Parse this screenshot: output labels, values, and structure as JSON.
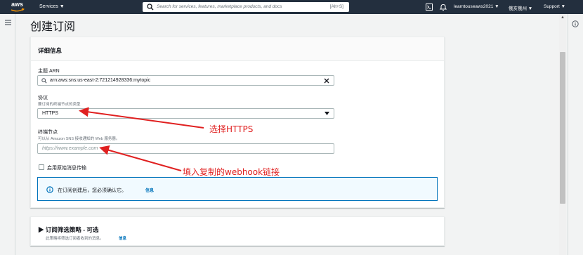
{
  "topnav": {
    "logo": "aws",
    "services": "Services ▼",
    "search_placeholder": "Search for services, features, marketplace products, and docs",
    "search_shortcut": "[Alt+S]",
    "account": "learntouseaws2021 ▼",
    "region": "俄亥俄州 ▼",
    "support": "Support ▼"
  },
  "page": {
    "title": "创建订阅"
  },
  "details": {
    "header": "详细信息",
    "topic_arn_label": "主题 ARN",
    "topic_arn_value": "arn:aws:sns:us-east-2:721214928336:mytopic",
    "protocol_label": "协议",
    "protocol_desc": "要订阅的终端节点的类型",
    "protocol_value": "HTTPS",
    "endpoint_label": "终端节点",
    "endpoint_desc": "可以从 Amazon SNS 接收通知的 Web 服务器。",
    "endpoint_placeholder": "https://www.example.com",
    "raw_delivery_label": "启用原始消息传输",
    "alert_text": "在订阅创建后，您必须确认它。",
    "alert_link": "信息"
  },
  "filter": {
    "title": "▶ 订阅筛选策略 - 可选",
    "desc": "此策略将筛选订阅者收到的消息。",
    "link": "信息"
  },
  "annotations": {
    "select_https": "选择HTTPS",
    "paste_webhook": "填入复制的webhook链接"
  },
  "colors": {
    "nav_bg": "#232f3e",
    "annotation": "#e02020",
    "link": "#0073bb"
  }
}
